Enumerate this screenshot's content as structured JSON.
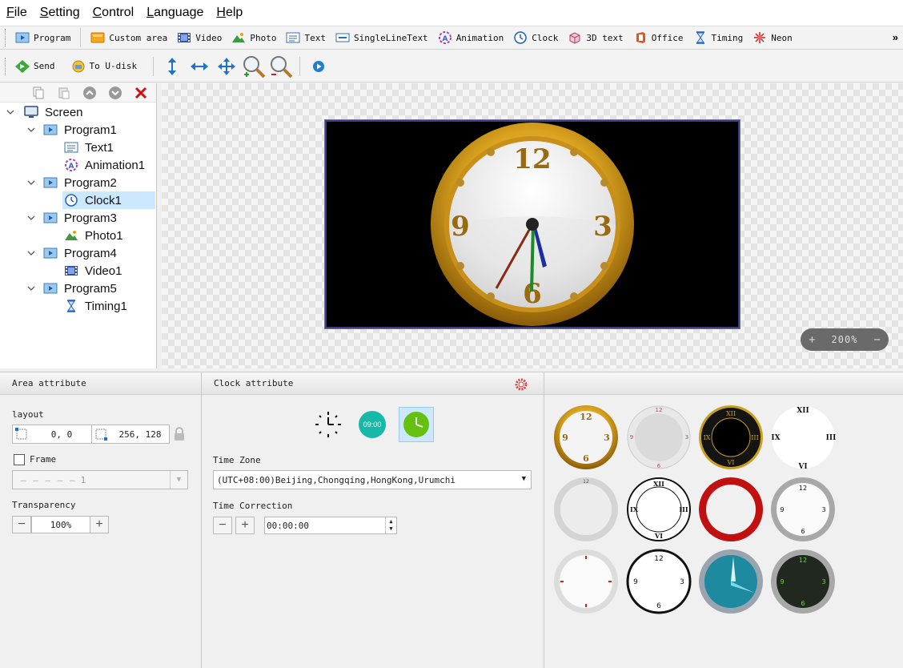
{
  "menu": [
    {
      "label": "File",
      "key": "F",
      "rest": "ile"
    },
    {
      "label": "Setting",
      "key": "S",
      "rest": "etting"
    },
    {
      "label": "Control",
      "key": "C",
      "rest": "ontrol"
    },
    {
      "label": "Language",
      "key": "L",
      "rest": "anguage"
    },
    {
      "label": "Help",
      "key": "H",
      "rest": "elp"
    }
  ],
  "toolbar1": {
    "program": "Program",
    "custom_area": "Custom area",
    "video": "Video",
    "photo": "Photo",
    "text": "Text",
    "single_line_text": "SingleLineText",
    "animation": "Animation",
    "clock": "Clock",
    "text3d": "3D text",
    "office": "Office",
    "timing": "Timing",
    "neon": "Neon",
    "more": "»"
  },
  "toolbar2": {
    "send": "Send",
    "to_udisk": "To U-disk"
  },
  "tree": {
    "screen": "Screen",
    "program1": "Program1",
    "text1": "Text1",
    "animation1": "Animation1",
    "program2": "Program2",
    "clock1": "Clock1",
    "program3": "Program3",
    "photo1": "Photo1",
    "program4": "Program4",
    "video1": "Video1",
    "program5": "Program5",
    "timing1": "Timing1"
  },
  "preview": {
    "clock_numerals": {
      "n12": "12",
      "n3": "3",
      "n6": "6",
      "n9": "9"
    },
    "zoom_minus": "−",
    "zoom_plus": "+",
    "zoom_value": "200%"
  },
  "area_attribute": {
    "title": "Area attribute",
    "layout_label": "layout",
    "position": "0,  0",
    "size": "256,  128",
    "frame_label": "Frame",
    "frame_value": "1",
    "transparency_label": "Transparency",
    "transparency_value": "100%",
    "minus": "−",
    "plus": "+"
  },
  "clock_attribute": {
    "title": "Clock attribute",
    "digital_label": "09:00",
    "timezone_label": "Time Zone",
    "timezone_value": "(UTC+08:00)Beijing,Chongqing,HongKong,Urumchi",
    "correction_label": "Time Correction",
    "correction_value": "00:00:00",
    "minus": "−",
    "plus": "+"
  },
  "colors": {
    "selection": "#cce8ff",
    "accent_blue": "#1e73c8",
    "gold": "#c8961e",
    "red_close": "#d01010"
  }
}
